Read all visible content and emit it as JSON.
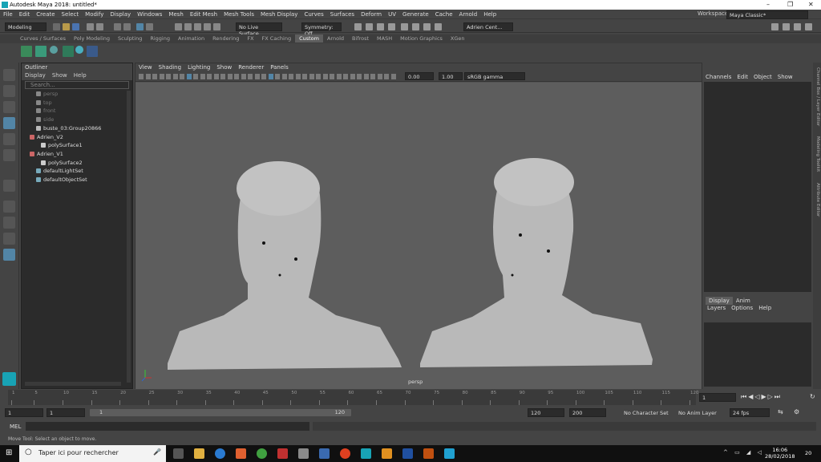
{
  "window": {
    "title": "Autodesk Maya 2018: untitled*"
  },
  "menubar": [
    "File",
    "Edit",
    "Create",
    "Select",
    "Modify",
    "Display",
    "Windows",
    "Mesh",
    "Edit Mesh",
    "Mesh Tools",
    "Mesh Display",
    "Curves",
    "Surfaces",
    "Deform",
    "UV",
    "Generate",
    "Cache",
    "Arnold",
    "Help"
  ],
  "workspace": {
    "label": "Workspace :",
    "value": "Maya Classic*"
  },
  "statusline": {
    "mode": "Modeling",
    "live_surface": "No Live Surface",
    "symmetry": "Symmetry: Off",
    "user": "Adrien Cent..."
  },
  "shelf": {
    "tabs": [
      "Curves / Surfaces",
      "Poly Modeling",
      "Sculpting",
      "Rigging",
      "Animation",
      "Rendering",
      "FX",
      "FX Caching",
      "Custom",
      "Arnold",
      "Bifrost",
      "MASH",
      "Motion Graphics",
      "XGen"
    ],
    "active": "Custom"
  },
  "outliner": {
    "title": "Outliner",
    "menu": [
      "Display",
      "Show",
      "Help"
    ],
    "search_placeholder": "Search...",
    "items": [
      {
        "label": "persp",
        "dim": true
      },
      {
        "label": "top",
        "dim": true
      },
      {
        "label": "front",
        "dim": true
      },
      {
        "label": "side",
        "dim": true
      },
      {
        "label": "buste_03:Group20866",
        "dim": false
      },
      {
        "label": "Adrien_V2",
        "dim": false
      },
      {
        "label": "polySurface1",
        "dim": false
      },
      {
        "label": "Adrien_V1",
        "dim": false
      },
      {
        "label": "polySurface2",
        "dim": false
      },
      {
        "label": "defaultLightSet",
        "dim": false
      },
      {
        "label": "defaultObjectSet",
        "dim": false
      }
    ]
  },
  "viewport": {
    "menu": [
      "View",
      "Shading",
      "Lighting",
      "Show",
      "Renderer",
      "Panels"
    ],
    "field1": "0.00",
    "field2": "1.00",
    "colorspace": "sRGB gamma",
    "camera_label": "persp"
  },
  "channelbox": {
    "menu": [
      "Channels",
      "Edit",
      "Object",
      "Show"
    ]
  },
  "layers": {
    "tabs": [
      "Display",
      "Anim"
    ],
    "menu": [
      "Layers",
      "Options",
      "Help"
    ]
  },
  "sidetabs": [
    "Channel Box / Layer Editor",
    "Modeling Toolkit",
    "Attribute Editor"
  ],
  "timeline": {
    "ticks": [
      "1",
      "5",
      "10",
      "15",
      "20",
      "25",
      "30",
      "35",
      "40",
      "45",
      "50",
      "55",
      "60",
      "65",
      "70",
      "75",
      "80",
      "85",
      "90",
      "95",
      "100",
      "105",
      "110",
      "115",
      "120"
    ],
    "current_frame": "1"
  },
  "range": {
    "start": "1",
    "playback_start": "1",
    "range_start_label": "1",
    "range_end_label": "120",
    "playback_end": "120",
    "end": "200",
    "character_set": "No Character Set",
    "anim_layer": "No Anim Layer",
    "fps": "24 fps"
  },
  "cmdline": {
    "label": "MEL"
  },
  "helpline": {
    "text": "Move Tool: Select an object to move."
  },
  "taskbar": {
    "search_placeholder": "Taper ici pour rechercher",
    "time": "16:06",
    "date": "28/02/2018",
    "notifications": "20"
  },
  "colors": {
    "accent": "#5285a6",
    "maya_teal": "#18a3b5"
  }
}
